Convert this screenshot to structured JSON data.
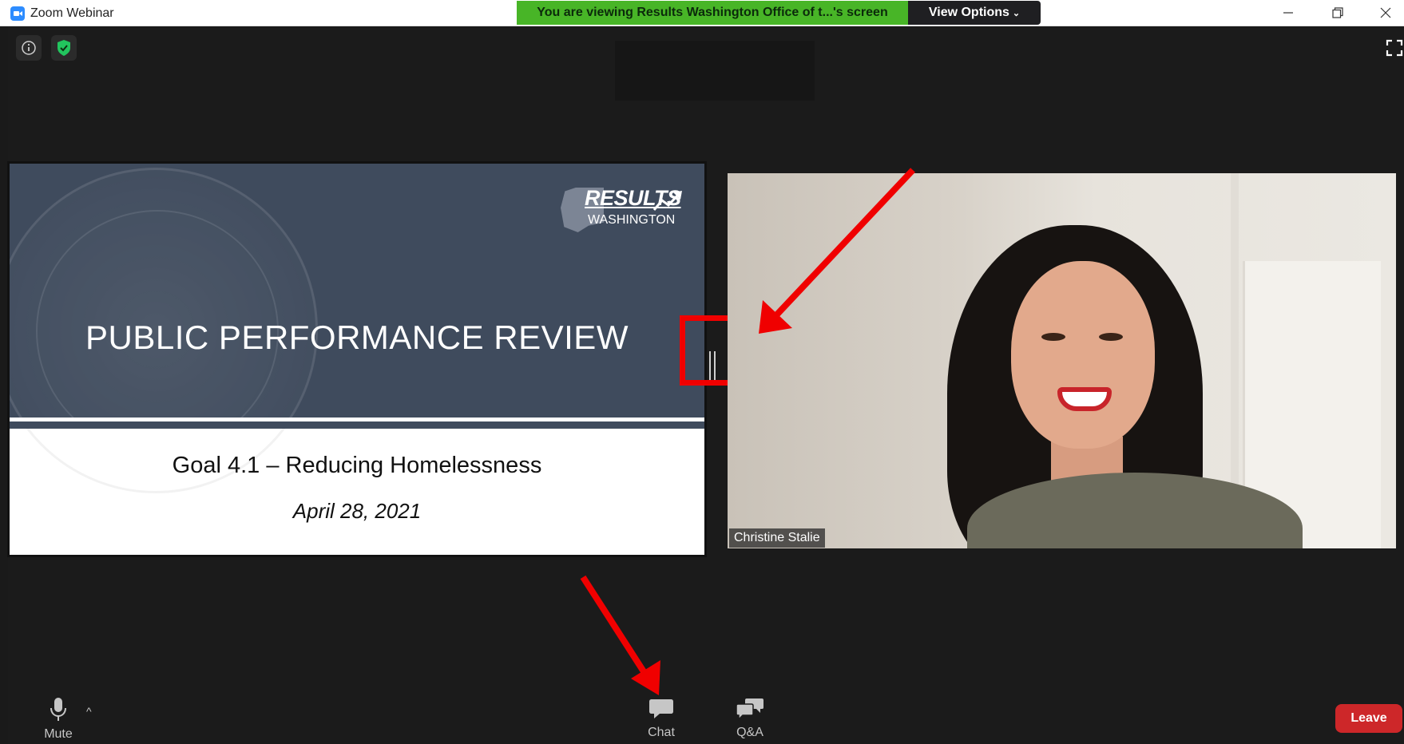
{
  "window": {
    "title": "Zoom Webinar",
    "share_banner": "You are viewing Results Washington Office of t...'s screen",
    "view_options": "View Options"
  },
  "slide": {
    "logo_primary": "RESULTS",
    "logo_secondary": "WASHINGTON",
    "title": "PUBLIC PERFORMANCE REVIEW",
    "subtitle": "Goal 4.1 – Reducing Homelessness",
    "date": "April 28, 2021"
  },
  "video": {
    "participant_name": "Christine Stalie"
  },
  "toolbar": {
    "mute_label": "Mute",
    "chat_label": "Chat",
    "qa_label": "Q&A",
    "leave_label": "Leave"
  },
  "colors": {
    "share_banner_bg": "#48b527",
    "leave_button": "#cd2729",
    "slide_header": "#3f4b5d",
    "annotation": "#f00000"
  },
  "icons": [
    "zoom-logo-icon",
    "minimize-icon",
    "restore-icon",
    "close-icon",
    "info-icon",
    "shield-check-icon",
    "fullscreen-icon",
    "microphone-icon",
    "caret-up-icon",
    "chat-icon",
    "qa-icon",
    "chevron-down-icon"
  ]
}
